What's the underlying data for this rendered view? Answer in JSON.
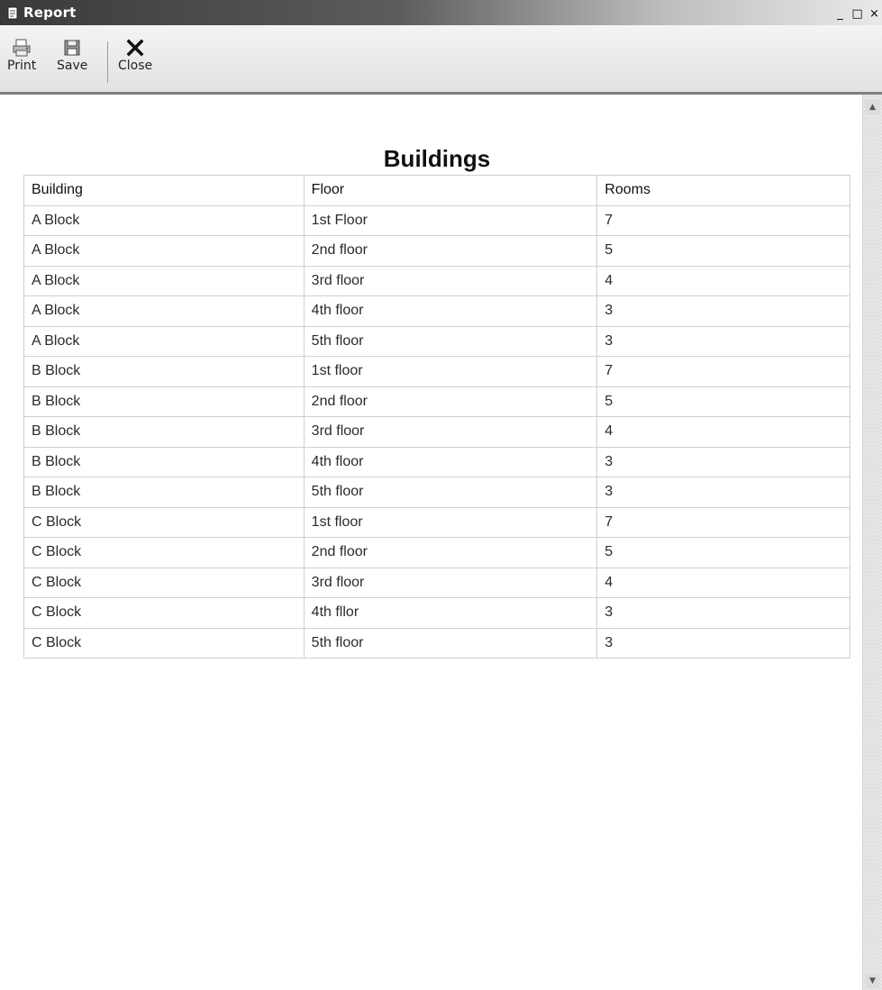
{
  "window": {
    "title": "Report",
    "controls": {
      "minimize": "_",
      "maximize": "□",
      "close": "×"
    }
  },
  "toolbar": {
    "print_label": "Print",
    "save_label": "Save",
    "close_label": "Close"
  },
  "report": {
    "title": "Buildings",
    "columns": [
      "Building",
      "Floor",
      "Rooms"
    ],
    "rows": [
      [
        "A Block",
        "1st Floor",
        "7"
      ],
      [
        "A Block",
        "2nd floor",
        "5"
      ],
      [
        "A Block",
        "3rd floor",
        "4"
      ],
      [
        "A Block",
        "4th floor",
        "3"
      ],
      [
        "A Block",
        "5th floor",
        "3"
      ],
      [
        "B Block",
        "1st floor",
        "7"
      ],
      [
        "B Block",
        "2nd floor",
        "5"
      ],
      [
        "B Block",
        "3rd floor",
        "4"
      ],
      [
        "B Block",
        "4th floor",
        "3"
      ],
      [
        "B Block",
        "5th floor",
        "3"
      ],
      [
        "C Block",
        "1st floor",
        "7"
      ],
      [
        "C Block",
        "2nd floor",
        "5"
      ],
      [
        "C Block",
        "3rd floor",
        "4"
      ],
      [
        "C Block",
        "4th fllor",
        "3"
      ],
      [
        "C Block",
        "5th floor",
        "3"
      ]
    ]
  },
  "icons": {
    "app": "report-document-icon",
    "print": "printer-icon",
    "save": "floppy-disk-icon",
    "close": "close-x-icon"
  },
  "colors": {
    "titlebar_dark": "#3a3a3a",
    "titlebar_light": "#e9e9e9",
    "table_border": "#cfcfcf"
  }
}
